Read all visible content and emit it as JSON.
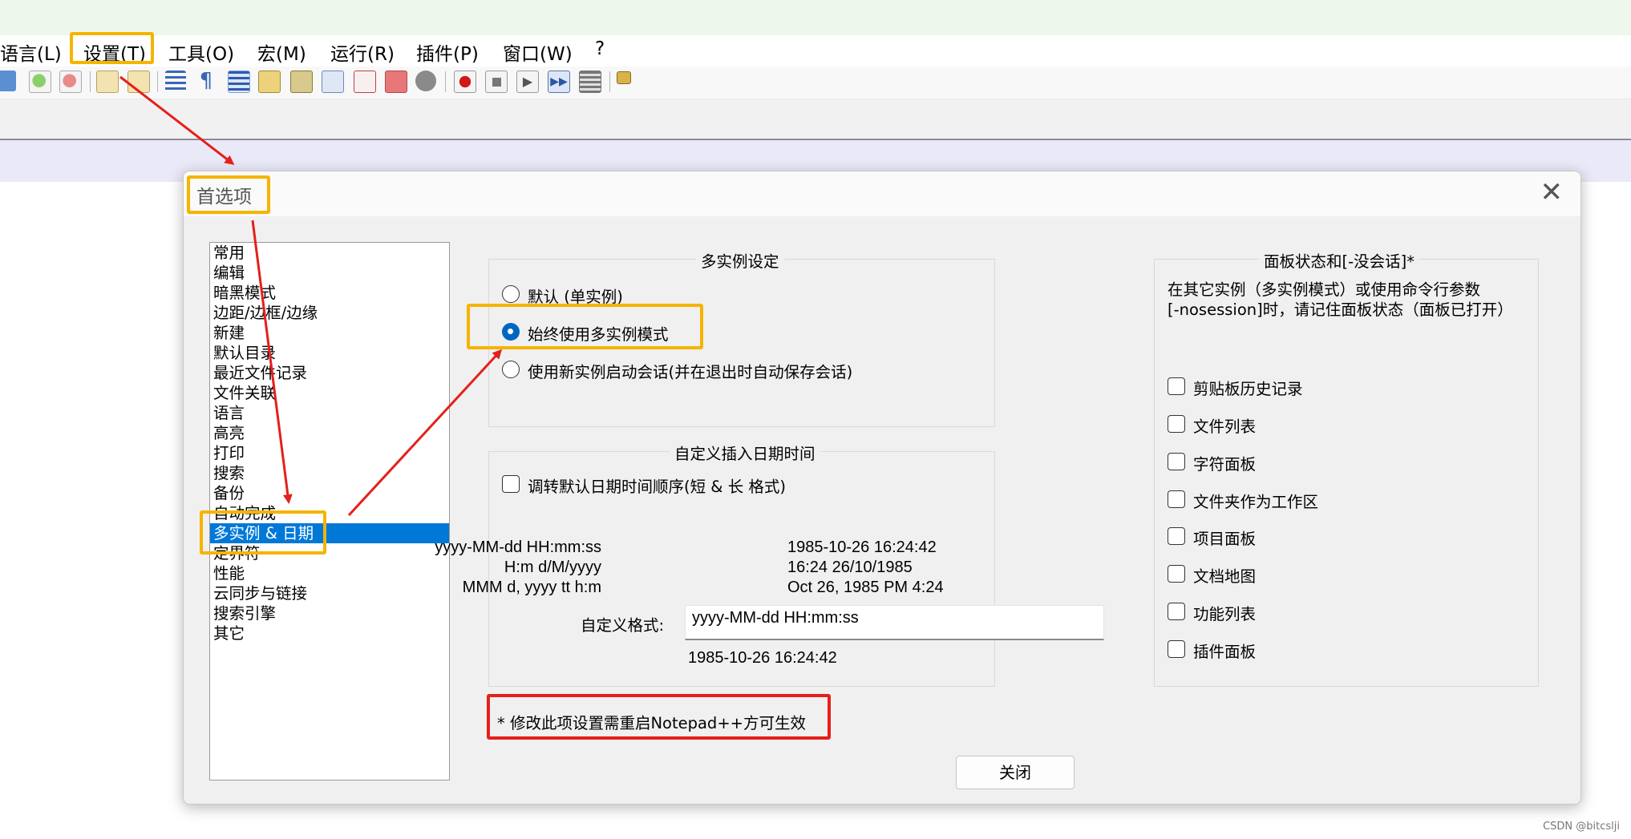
{
  "menubar": {
    "items": [
      "语言(L)",
      "设置(T)",
      "工具(O)",
      "宏(M)",
      "运行(R)",
      "插件(P)",
      "窗口(W)",
      "?"
    ]
  },
  "toolbar": {
    "icons": [
      "document-map-icon",
      "zoom-in-icon",
      "zoom-out-icon",
      "sync-vertical-icon",
      "sync-horizontal-icon",
      "word-wrap-icon",
      "show-all-chars-icon",
      "indent-guide-icon",
      "user-defined-language-icon",
      "document-map-panel-icon",
      "document-list-icon",
      "function-list-icon",
      "folder-as-workspace-icon",
      "monitoring-icon",
      "record-macro-icon",
      "stop-record-icon",
      "play-macro-icon",
      "run-macro-multiple-icon",
      "save-macro-icon",
      "plugin-icon"
    ]
  },
  "dialog": {
    "title": "首选项",
    "close_glyph": "✕",
    "categories": [
      "常用",
      "编辑",
      "暗黑模式",
      "边距/边框/边缘",
      "新建",
      "默认目录",
      "最近文件记录",
      "文件关联",
      "语言",
      "高亮",
      "打印",
      "搜索",
      "备份",
      "自动完成",
      "多实例 & 日期",
      "定界符",
      "性能",
      "云同步与链接",
      "搜索引擎",
      "其它"
    ],
    "selected_category": "多实例 & 日期",
    "multi_instance": {
      "title": "多实例设定",
      "options": [
        "默认 (单实例)",
        "始终使用多实例模式",
        "使用新实例启动会话(并在退出时自动保存会话)"
      ],
      "selected": "始终使用多实例模式"
    },
    "datetime": {
      "title": "自定义插入日期时间",
      "reverse_label": "调转默认日期时间顺序(短 & 长 格式)",
      "reverse_checked": false,
      "examples": [
        {
          "format": "yyyy-MM-dd HH:mm:ss",
          "value": "1985-10-26 16:24:42"
        },
        {
          "format": "H:m d/M/yyyy",
          "value": "16:24 26/10/1985"
        },
        {
          "format": "MMM d, yyyy  tt h:m",
          "value": "Oct 26, 1985  PM 4:24"
        }
      ],
      "custom_label": "自定义格式:",
      "custom_value": "yyyy-MM-dd HH:mm:ss",
      "preview": "1985-10-26 16:24:42"
    },
    "panel_state": {
      "title": "面板状态和[-没会话]*",
      "description_line1": "在其它实例（多实例模式）或使用命令行参数",
      "description_line2": "[-nosession]时，请记住面板状态（面板已打开）",
      "items": [
        "剪贴板历史记录",
        "文件列表",
        "字符面板",
        "文件夹作为工作区",
        "项目面板",
        "文档地图",
        "功能列表",
        "插件面板"
      ]
    },
    "restart_note": "* 修改此项设置需重启Notepad++方可生效",
    "close_button": "关闭"
  },
  "watermark": "CSDN @bitcslji",
  "colors": {
    "highlight_orange": "#f5b400",
    "annotation_red": "#e4201a",
    "selection_blue": "#0078d7",
    "radio_blue": "#0067c0"
  }
}
